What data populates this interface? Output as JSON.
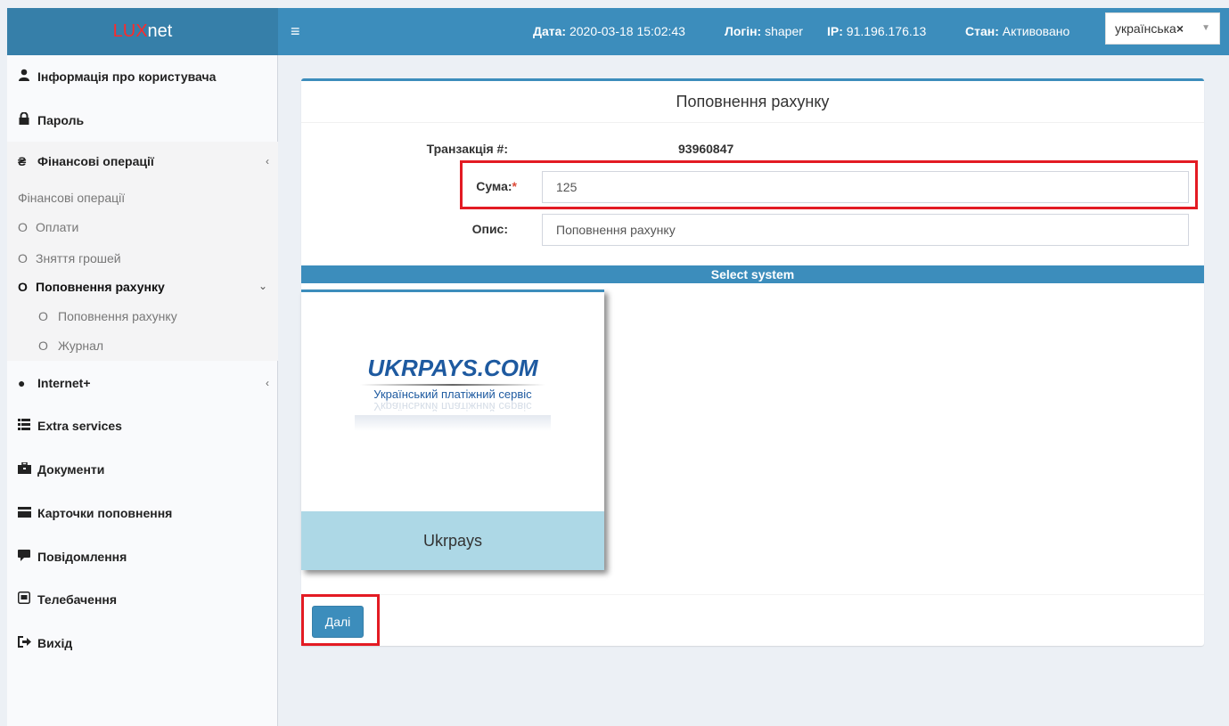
{
  "header": {
    "logo_lux": "LUX",
    "logo_net": "net",
    "menu_icon": "≡",
    "date_label": "Дата:",
    "date_value": "2020-03-18 15:02:43",
    "login_label": "Логін:",
    "login_value": "shaper",
    "ip_label": "IP:",
    "ip_value": "91.196.176.13",
    "status_label": "Стан:",
    "status_value": "Активовано",
    "language": "українська",
    "language_clear": "×"
  },
  "sidebar": {
    "items": [
      {
        "label": "Інформація про користувача",
        "icon": "user-icon"
      },
      {
        "label": "Пароль",
        "icon": "lock-icon"
      },
      {
        "label": "Фінансові операції",
        "icon": "hryvnia-icon"
      },
      {
        "label": "Internet+",
        "icon": "circle-icon"
      },
      {
        "label": "Extra services",
        "icon": "list-icon"
      },
      {
        "label": "Документи",
        "icon": "briefcase-icon"
      },
      {
        "label": "Карточки поповнення",
        "icon": "card-icon"
      },
      {
        "label": "Повідомлення",
        "icon": "comment-icon"
      },
      {
        "label": "Телебачення",
        "icon": "tv-icon"
      },
      {
        "label": "Вихід",
        "icon": "sign-out-icon"
      }
    ],
    "finance_header": "Фінансові операції",
    "finance_sub": [
      "Оплати",
      "Зняття грошей",
      "Поповнення рахунку"
    ],
    "topup_sub": [
      "Поповнення рахунку",
      "Журнал"
    ]
  },
  "form": {
    "title": "Поповнення рахунку",
    "transaction_label": "Транзакція #:",
    "transaction_value": "93960847",
    "amount_label": "Сума:",
    "amount_required": "*",
    "amount_value": "125",
    "description_label": "Опис:",
    "description_value": "Поповнення рахунку",
    "select_system_label": "Select system",
    "payment_systems": [
      {
        "name": "Ukrpays",
        "logo_text": "UKRPAYS.COM",
        "logo_subtitle": "Український платіжний сервіс"
      }
    ],
    "next_button": "Далі"
  },
  "colors": {
    "header_bg": "#3c8dbc",
    "logo_bg": "#367fa9",
    "logo_lux": "#ff2a2a",
    "highlight": "#e31b23",
    "card_footer": "#add8e6"
  }
}
